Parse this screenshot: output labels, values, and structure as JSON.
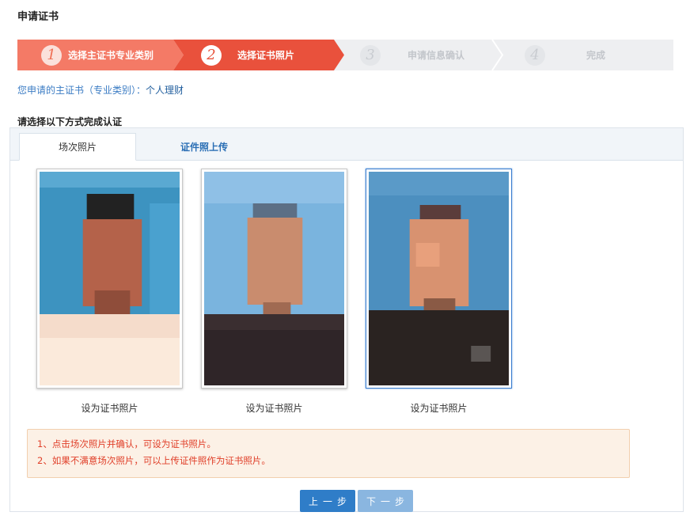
{
  "page": {
    "title": "申请证书"
  },
  "steps": [
    {
      "number": "1",
      "label": "选择主证书专业类别",
      "state": "done"
    },
    {
      "number": "2",
      "label": "选择证书照片",
      "state": "active"
    },
    {
      "number": "3",
      "label": "申请信息确认",
      "state": "todo"
    },
    {
      "number": "4",
      "label": "完成",
      "state": "todo"
    }
  ],
  "certificate": {
    "prefix": "您申请的主证书（专业类别）：",
    "value": "个人理财"
  },
  "choose_label": "请选择以下方式完成认证",
  "tabs": [
    {
      "label": "场次照片",
      "active": true
    },
    {
      "label": "证件照上传",
      "active": false
    }
  ],
  "photos": [
    {
      "caption": "设为证书照片",
      "selected": false
    },
    {
      "caption": "设为证书照片",
      "selected": false
    },
    {
      "caption": "设为证书照片",
      "selected": true
    }
  ],
  "notice": {
    "line1": "1、点击场次照片并确认，可设为证书照片。",
    "line2": "2、如果不满意场次照片，可以上传证件照作为证书照片。"
  },
  "buttons": {
    "prev": "上一步",
    "next": "下一步"
  },
  "colors": {
    "step_done": "#f47a66",
    "step_active": "#e9513c",
    "step_todo": "#eeeff1",
    "link": "#2b6fb5",
    "notice_text": "#e0402a"
  }
}
